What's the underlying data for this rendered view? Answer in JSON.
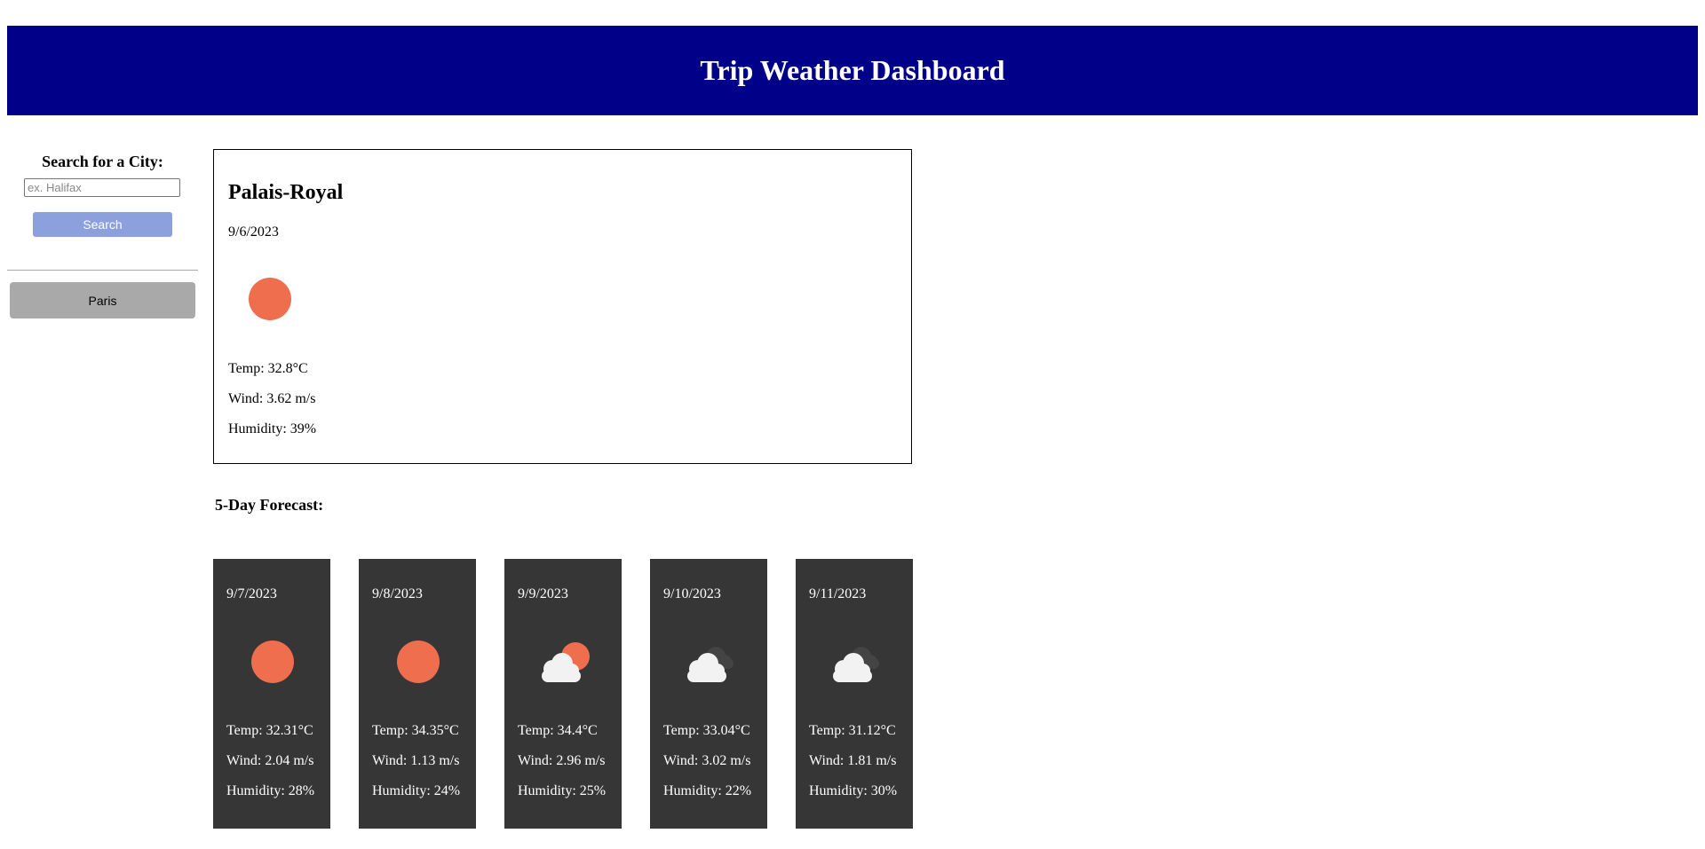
{
  "header": {
    "title": "Trip Weather Dashboard"
  },
  "sidebar": {
    "title": "Search for a City:",
    "search_placeholder": "ex. Halifax",
    "search_value": "",
    "search_button_label": "Search",
    "history": [
      "Paris"
    ]
  },
  "current": {
    "city": "Palais-Royal",
    "date": "9/6/2023",
    "icon": "sun-icon",
    "temp": "Temp: 32.8°C",
    "wind": "Wind: 3.62 m/s",
    "humidity": "Humidity: 39%"
  },
  "forecast": {
    "heading": "5-Day Forecast:",
    "days": [
      {
        "date": "9/7/2023",
        "icon": "sun-icon",
        "temp": "Temp: 32.31°C",
        "wind": "Wind: 2.04 m/s",
        "humidity": "Humidity: 28%"
      },
      {
        "date": "9/8/2023",
        "icon": "sun-icon",
        "temp": "Temp: 34.35°C",
        "wind": "Wind: 1.13 m/s",
        "humidity": "Humidity: 24%"
      },
      {
        "date": "9/9/2023",
        "icon": "partly-cloudy-icon",
        "temp": "Temp: 34.4°C",
        "wind": "Wind: 2.96 m/s",
        "humidity": "Humidity: 25%"
      },
      {
        "date": "9/10/2023",
        "icon": "cloudy-icon",
        "temp": "Temp: 33.04°C",
        "wind": "Wind: 3.02 m/s",
        "humidity": "Humidity: 22%"
      },
      {
        "date": "9/11/2023",
        "icon": "cloudy-icon",
        "temp": "Temp: 31.12°C",
        "wind": "Wind: 1.81 m/s",
        "humidity": "Humidity: 30%"
      }
    ]
  },
  "colors": {
    "header_bg": "#000088",
    "search_button_bg": "#8ca0de",
    "history_button_bg": "#a9a9a9",
    "forecast_card_bg": "#363636",
    "sun": "#ee6e4d",
    "cloud_front": "#f2f2f2",
    "cloud_back": "#444444"
  }
}
